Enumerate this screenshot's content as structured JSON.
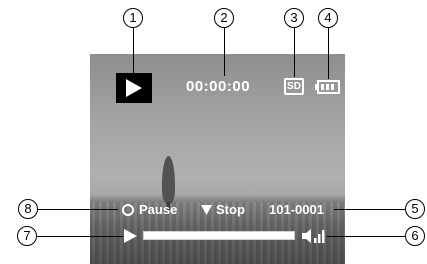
{
  "callouts": {
    "c1": "1",
    "c2": "2",
    "c3": "3",
    "c4": "4",
    "c5": "5",
    "c6": "6",
    "c7": "7",
    "c8": "8"
  },
  "overlay": {
    "play_icon": "play-icon",
    "timecode": "00:00:00",
    "storage_label": "SD",
    "battery_icon": "battery-full-icon",
    "pause_label": "Pause",
    "stop_label": "Stop",
    "file_number": "101-0001",
    "progress_fraction": 1.0,
    "volume_icon": "volume-icon"
  },
  "colors": {
    "overlay_text": "#ffffff",
    "play_box_bg": "#000000"
  }
}
